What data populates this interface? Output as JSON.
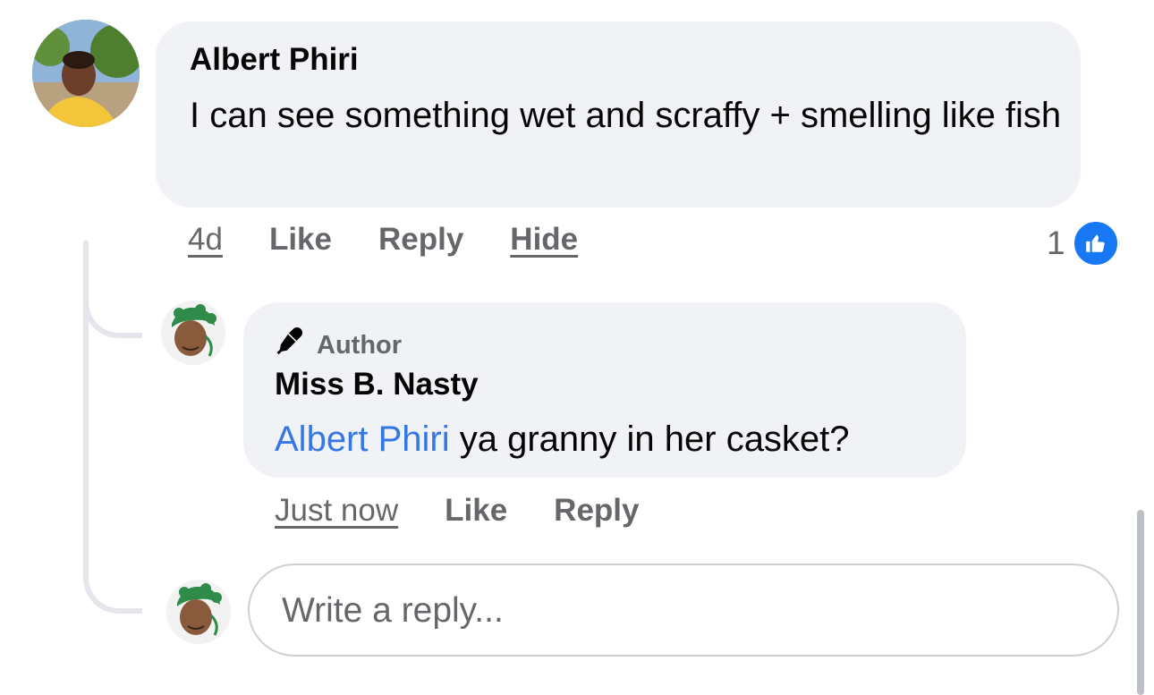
{
  "comment": {
    "author": "Albert Phiri",
    "text": "I can see something wet and scraffy + smelling like fish",
    "time": "4d",
    "like_label": "Like",
    "reply_label": "Reply",
    "hide_label": "Hide",
    "reaction_count": "1"
  },
  "reply": {
    "badge": "Author",
    "author": "Miss B. Nasty",
    "mention": "Albert Phiri",
    "text": " ya granny in her casket?",
    "time": "Just now",
    "like_label": "Like",
    "reply_label": "Reply"
  },
  "composer": {
    "placeholder": "Write a reply..."
  },
  "colors": {
    "bubble": "#f0f2f5",
    "mention": "#3578e5",
    "like_reaction": "#1877f2",
    "muted_text": "#65676b"
  },
  "icons": {
    "badge": "microphone-icon",
    "reaction": "thumbs-up-icon"
  }
}
